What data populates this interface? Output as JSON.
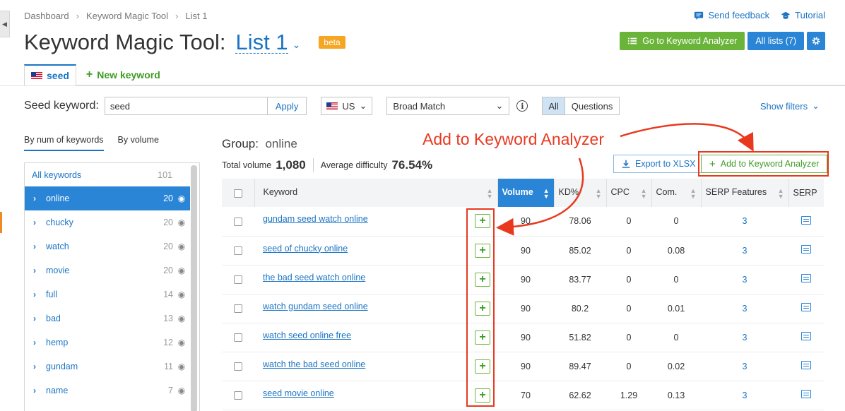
{
  "breadcrumb": [
    "Dashboard",
    "Keyword Magic Tool",
    "List 1"
  ],
  "top_links": {
    "feedback": "Send feedback",
    "tutorial": "Tutorial"
  },
  "title": {
    "main": "Keyword Magic Tool:",
    "list": "List 1",
    "badge": "beta"
  },
  "buttons": {
    "go_analyzer": "Go to Keyword Analyzer",
    "all_lists": "All lists (7)"
  },
  "tabs": {
    "seed": "seed",
    "new_keyword": "New keyword"
  },
  "seed_row": {
    "label": "Seed keyword:",
    "value": "seed",
    "apply": "Apply",
    "country": "US",
    "match": "Broad Match",
    "seg_all": "All",
    "seg_questions": "Questions",
    "show_filters": "Show filters"
  },
  "side_tabs": {
    "by_num": "By num of keywords",
    "by_volume": "By volume"
  },
  "sidebar": {
    "all_label": "All keywords",
    "all_count": "101",
    "items": [
      {
        "name": "online",
        "count": "20"
      },
      {
        "name": "chucky",
        "count": "20"
      },
      {
        "name": "watch",
        "count": "20"
      },
      {
        "name": "movie",
        "count": "20"
      },
      {
        "name": "full",
        "count": "14"
      },
      {
        "name": "bad",
        "count": "13"
      },
      {
        "name": "hemp",
        "count": "12"
      },
      {
        "name": "gundam",
        "count": "11"
      },
      {
        "name": "name",
        "count": "7"
      }
    ]
  },
  "group": {
    "label": "Group:",
    "name": "online",
    "total_volume_label": "Total volume",
    "total_volume": "1,080",
    "avg_difficulty_label": "Average difficulty",
    "avg_difficulty": "76.54%"
  },
  "actions": {
    "export": "Export to XLSX",
    "add_analyzer": "Add to Keyword Analyzer"
  },
  "annotation": {
    "text": "Add to Keyword Analyzer"
  },
  "table": {
    "headers": {
      "keyword": "Keyword",
      "volume": "Volume",
      "kd": "KD%",
      "cpc": "CPC",
      "com": "Com.",
      "serp_features": "SERP Features",
      "serp": "SERP"
    },
    "rows": [
      {
        "keyword": "gundam seed watch online",
        "volume": "90",
        "kd": "78.06",
        "cpc": "0",
        "com": "0",
        "serp_features": "3"
      },
      {
        "keyword": "seed of chucky online",
        "volume": "90",
        "kd": "85.02",
        "cpc": "0",
        "com": "0.08",
        "serp_features": "3"
      },
      {
        "keyword": "the bad seed watch online",
        "volume": "90",
        "kd": "83.77",
        "cpc": "0",
        "com": "0",
        "serp_features": "3"
      },
      {
        "keyword": "watch gundam seed online",
        "volume": "90",
        "kd": "80.2",
        "cpc": "0",
        "com": "0.01",
        "serp_features": "3"
      },
      {
        "keyword": "watch seed online free",
        "volume": "90",
        "kd": "51.82",
        "cpc": "0",
        "com": "0",
        "serp_features": "3"
      },
      {
        "keyword": "watch the bad seed online",
        "volume": "90",
        "kd": "89.47",
        "cpc": "0",
        "com": "0.02",
        "serp_features": "3"
      },
      {
        "keyword": "seed movie online",
        "volume": "70",
        "kd": "62.62",
        "cpc": "1.29",
        "com": "0.13",
        "serp_features": "3"
      }
    ]
  },
  "colors": {
    "accent": "#2a85d6",
    "green": "#6bb43a",
    "annotation_red": "#e8391f",
    "beta": "#f5a623"
  }
}
